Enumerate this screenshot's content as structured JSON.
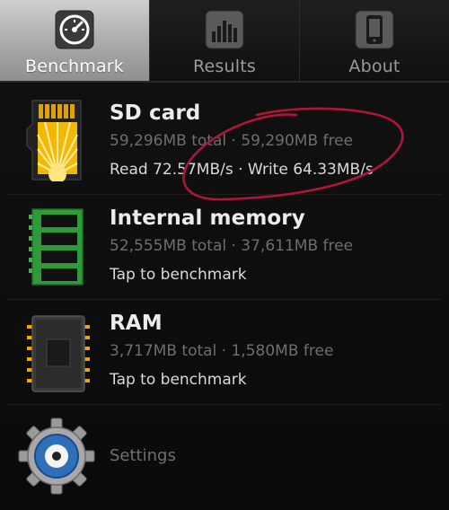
{
  "tabs": [
    {
      "label": "Benchmark",
      "icon": "speedometer-icon",
      "active": true
    },
    {
      "label": "Results",
      "icon": "bar-chart-icon",
      "active": false
    },
    {
      "label": "About",
      "icon": "phone-icon",
      "active": false
    }
  ],
  "storage": [
    {
      "title": "SD card",
      "subtitle": "59,296MB total · 59,290MB free",
      "detail": "Read 72.57MB/s · Write 64.33MB/s",
      "icon": "sd-card-icon"
    },
    {
      "title": "Internal memory",
      "subtitle": "52,555MB total · 37,611MB free",
      "detail": "Tap to benchmark",
      "icon": "memory-module-icon"
    },
    {
      "title": "RAM",
      "subtitle": "3,717MB total · 1,580MB free",
      "detail": "Tap to benchmark",
      "icon": "ram-chip-icon"
    }
  ],
  "settings": {
    "label": "Settings",
    "icon": "gear-icon"
  },
  "colors": {
    "scribble": "#b0153a",
    "active_tab": "#a9a9a9",
    "chip_green": "#2f9a3a",
    "sd_yellow": "#f5b800"
  }
}
